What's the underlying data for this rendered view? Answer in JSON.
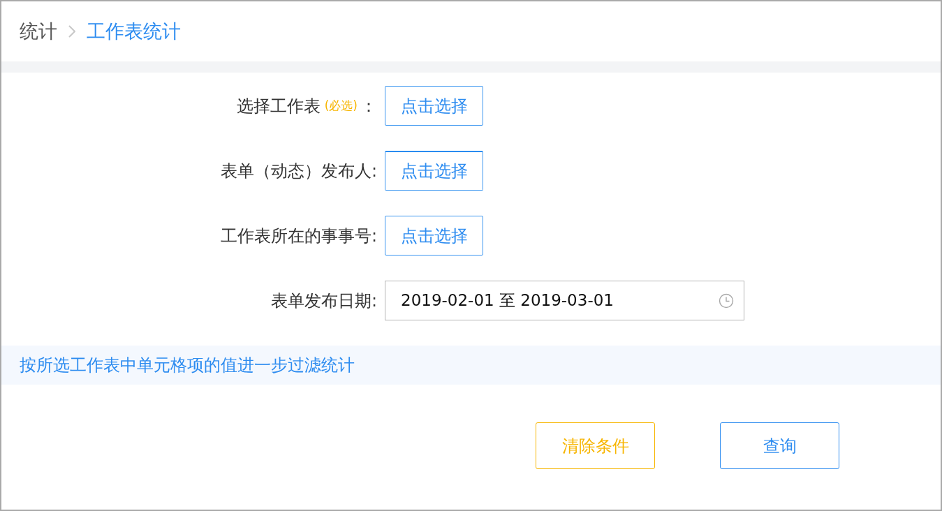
{
  "breadcrumb": [
    {
      "label": "统计",
      "selected": false
    },
    {
      "label": "工作表统计",
      "selected": true
    }
  ],
  "form": {
    "fields": [
      {
        "kind": "picker",
        "label": "选择工作表",
        "note": "(必选)",
        "suffix": "：",
        "button": "点击选择",
        "focused": false
      },
      {
        "kind": "picker",
        "label": "表单（动态）发布人:",
        "button": "点击选择",
        "focused": true
      },
      {
        "kind": "picker",
        "label": "工作表所在的事事号:",
        "button": "点击选择",
        "focused": false
      },
      {
        "kind": "date_range",
        "label": "表单发布日期:",
        "value": "2019-02-01 至 2019-03-01"
      }
    ]
  },
  "filter_link": "按所选工作表中单元格项的值进一步过滤统计",
  "actions": [
    {
      "kind": "secondary",
      "label": "清除条件"
    },
    {
      "kind": "primary",
      "label": "查询"
    }
  ]
}
